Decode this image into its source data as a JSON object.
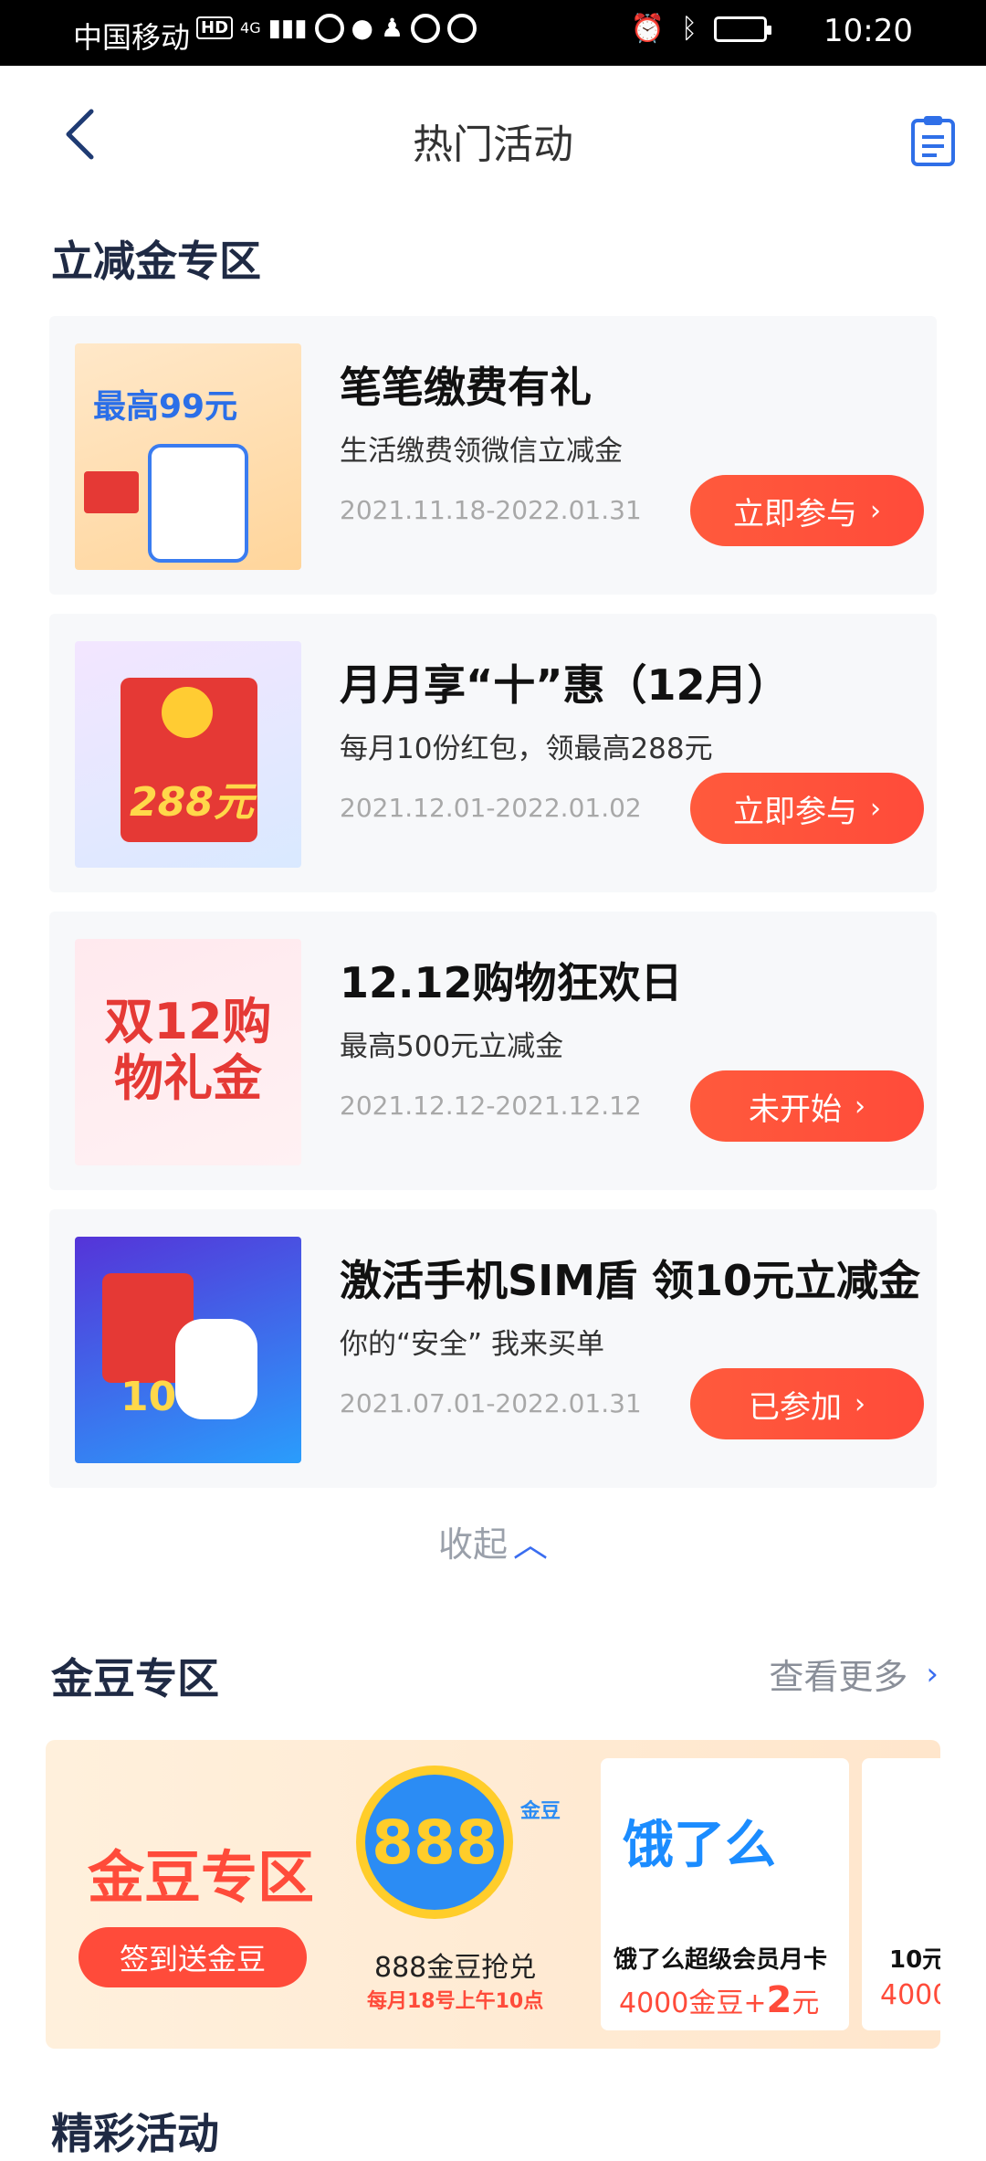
{
  "status_bar": {
    "carrier": "中国移动",
    "hd": "HD",
    "network": "4G",
    "time": "10:20"
  },
  "nav": {
    "title": "热门活动"
  },
  "section_discount": {
    "title": "立减金专区",
    "cards": [
      {
        "thumb_text": "最高99元",
        "title": "笔笔缴费有礼",
        "subtitle": "生活缴费领微信立减金",
        "date": "2021.11.18-2022.01.31",
        "button": "立即参与"
      },
      {
        "thumb_text": "288元",
        "title": "月月享“十”惠（12月）",
        "subtitle": "每月10份红包，领最高288元",
        "date": "2021.12.01-2022.01.02",
        "button": "立即参与"
      },
      {
        "thumb_text": "双12购物礼金",
        "title": "12.12购物狂欢日",
        "subtitle": "最高500元立减金",
        "date": "2021.12.12-2021.12.12",
        "button": "未开始"
      },
      {
        "thumb_text": "10",
        "title": "激活手机SIM盾 领10元立减金",
        "subtitle": "你的“安全” 我来买单",
        "date": "2021.07.01-2022.01.31",
        "button": "已参加"
      }
    ],
    "collapse_label": "收起"
  },
  "section_beans": {
    "title": "金豆专区",
    "more_label": "查看更多",
    "banner": {
      "heading": "金豆专区",
      "signin_button": "签到送金豆",
      "item_888": {
        "badge": "888",
        "badge_tag": "金豆",
        "title": "888金豆抢兑",
        "subtitle": "每月18号上午10点"
      },
      "item_ele": {
        "logo": "饿了么",
        "title": "饿了么超级会员月卡",
        "price_prefix": "4000金豆+",
        "price_amount": "2",
        "price_unit": "元"
      },
      "item_partial": {
        "title": "10元",
        "price": "4000"
      }
    }
  },
  "section_events": {
    "title": "精彩活动"
  }
}
